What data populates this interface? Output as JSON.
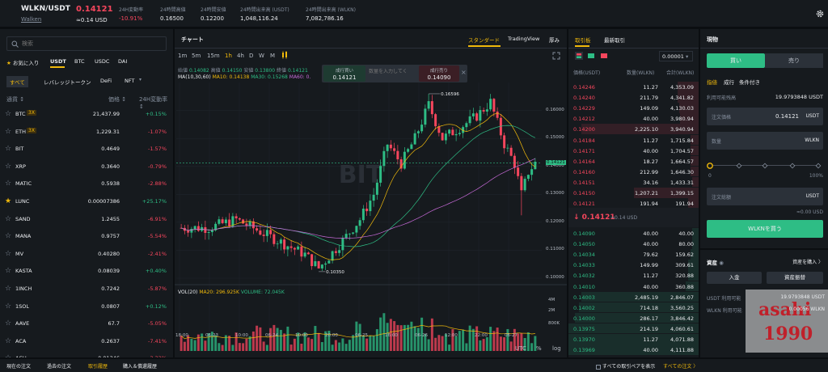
{
  "header": {
    "pair": "WLKN/USDT",
    "sub": "Walken",
    "price": "0.14121",
    "price_usd": "≈0.14 USD",
    "stats": [
      {
        "label": "24H変動率",
        "value": "-10.91%",
        "color": "#f6465d"
      },
      {
        "label": "24時間高値",
        "value": "0.16500"
      },
      {
        "label": "24時間安値",
        "value": "0.12200"
      },
      {
        "label": "24時間出来高 (USDT)",
        "value": "1,048,116.24"
      },
      {
        "label": "24時間出来高 (WLKN)",
        "value": "7,082,786.16"
      }
    ]
  },
  "market": {
    "search_placeholder": "検索",
    "tabs": [
      "お気に入り",
      "USDT",
      "BTC",
      "USDC",
      "DAI"
    ],
    "subtabs": [
      "すべて",
      "レバレッジトークン",
      "DeFi",
      "NFT"
    ],
    "col_pair": "通貨 ↕",
    "col_price": "価格 ↕",
    "col_change": "24H変動率 ↕",
    "rows": [
      {
        "sym": "BTC",
        "lev": "3X",
        "price": "21,437.99",
        "change": "+0.15%",
        "up": true,
        "fav": false
      },
      {
        "sym": "ETH",
        "lev": "3X",
        "price": "1,229.31",
        "change": "-1.07%",
        "up": false,
        "fav": false
      },
      {
        "sym": "BIT",
        "lev": "",
        "price": "0.4649",
        "change": "-1.57%",
        "up": false,
        "fav": false
      },
      {
        "sym": "XRP",
        "lev": "",
        "price": "0.3640",
        "change": "-0.79%",
        "up": false,
        "fav": false
      },
      {
        "sym": "MATIC",
        "lev": "",
        "price": "0.5938",
        "change": "-2.88%",
        "up": false,
        "fav": false
      },
      {
        "sym": "LUNC",
        "lev": "",
        "price": "0.00007386",
        "change": "+25.17%",
        "up": true,
        "fav": true
      },
      {
        "sym": "SAND",
        "lev": "",
        "price": "1.2455",
        "change": "-6.91%",
        "up": false,
        "fav": false
      },
      {
        "sym": "MANA",
        "lev": "",
        "price": "0.9757",
        "change": "-5.54%",
        "up": false,
        "fav": false
      },
      {
        "sym": "MV",
        "lev": "",
        "price": "0.40280",
        "change": "-2.41%",
        "up": false,
        "fav": false
      },
      {
        "sym": "KASTA",
        "lev": "",
        "price": "0.08039",
        "change": "+0.40%",
        "up": true,
        "fav": false
      },
      {
        "sym": "1INCH",
        "lev": "",
        "price": "0.7242",
        "change": "-5.87%",
        "up": false,
        "fav": false
      },
      {
        "sym": "1SOL",
        "lev": "",
        "price": "0.0807",
        "change": "+0.12%",
        "up": true,
        "fav": false
      },
      {
        "sym": "AAVE",
        "lev": "",
        "price": "67.7",
        "change": "-5.05%",
        "up": false,
        "fav": false
      },
      {
        "sym": "ACA",
        "lev": "",
        "price": "0.2637",
        "change": "-7.41%",
        "up": false,
        "fav": false
      },
      {
        "sym": "ACH",
        "lev": "",
        "price": "0.01346",
        "change": "-3.32%",
        "up": false,
        "fav": false
      }
    ]
  },
  "chart": {
    "title": "チャート",
    "view_tabs": [
      "スタンダード",
      "TradingView",
      "厚み"
    ],
    "intervals": [
      "1m",
      "5m",
      "15m",
      "1h",
      "4h",
      "D",
      "W",
      "M"
    ],
    "ohlc": {
      "open_l": "始値",
      "open": "0.14082",
      "high_l": "高値",
      "high": "0.14150",
      "low_l": "安値",
      "low": "0.13800",
      "close_l": "終値",
      "close": "0.14121"
    },
    "ma_label": "MA(10,30,60)",
    "ma10": "MA10: 0.14138",
    "ma30": "MA30: 0.15268",
    "ma60": "MA60: 0.",
    "quick_buy": "成行買い",
    "quick_buy_price": "0.14121",
    "qty_placeholder": "数量を入力してく",
    "quick_sell": "成行売り",
    "quick_sell_price": "0.14090",
    "watermark": "BIT",
    "vol_label": "VOL(20)",
    "vol_ma20": "MA20: 296.925K",
    "vol_volume": "VOLUME: 72.045K",
    "vol_axis": [
      "4M",
      "2M",
      "800K"
    ],
    "price_axis": [
      "0.16000",
      "0.15000",
      "0.14000",
      "0.13000",
      "0.12000",
      "0.11000",
      "0.10000"
    ],
    "last_price_tag": "0.14121",
    "high_mark": "0.16596",
    "low_mark": "0.10350",
    "time_axis": [
      "18:00",
      "06-23",
      "10:00",
      "06-24",
      "10:00",
      "20:00",
      "06-25",
      "16:00",
      "06-26",
      "12:00",
      "22:00",
      "06-27"
    ],
    "footer": [
      "UTC",
      "%",
      "log"
    ],
    "colors": {
      "up": "#2ebd85",
      "down": "#f6465d",
      "ma10": "#f0b90b",
      "ma30": "#2ebd85",
      "ma60": "#c76ad8"
    }
  },
  "orderbook": {
    "tabs": [
      "取引板",
      "最新取引"
    ],
    "precision": "0.00001",
    "col_price": "価格(USDT)",
    "col_qty": "数量(WLKN)",
    "col_total": "合計(WLKN)",
    "asks": [
      [
        "0.14246",
        "11.27",
        "4,353.09"
      ],
      [
        "0.14240",
        "211.79",
        "4,341.82"
      ],
      [
        "0.14229",
        "149.09",
        "4,130.03"
      ],
      [
        "0.14212",
        "40.00",
        "3,980.94"
      ],
      [
        "0.14200",
        "2,225.10",
        "3,940.94"
      ],
      [
        "0.14184",
        "11.27",
        "1,715.84"
      ],
      [
        "0.14171",
        "40.00",
        "1,704.57"
      ],
      [
        "0.14164",
        "18.27",
        "1,664.57"
      ],
      [
        "0.14160",
        "212.99",
        "1,646.30"
      ],
      [
        "0.14151",
        "34.16",
        "1,433.31"
      ],
      [
        "0.14150",
        "1,207.21",
        "1,399.15"
      ],
      [
        "0.14121",
        "191.94",
        "191.94"
      ]
    ],
    "ask_depth": [
      0.16,
      0.16,
      0.15,
      0.14,
      0.9,
      0.06,
      0.06,
      0.06,
      0.06,
      0.05,
      0.5,
      0.08
    ],
    "last_price": "↓ 0.14121",
    "last_usd": "≈0.14 USD",
    "bids": [
      [
        "0.14090",
        "40.00",
        "40.00"
      ],
      [
        "0.14050",
        "40.00",
        "80.00"
      ],
      [
        "0.14034",
        "79.62",
        "159.62"
      ],
      [
        "0.14033",
        "149.99",
        "309.61"
      ],
      [
        "0.14032",
        "11.27",
        "320.88"
      ],
      [
        "0.14010",
        "40.00",
        "360.88"
      ],
      [
        "0.14003",
        "2,485.19",
        "2,846.07"
      ],
      [
        "0.14002",
        "714.18",
        "3,560.25"
      ],
      [
        "0.14000",
        "286.17",
        "3,846.42"
      ],
      [
        "0.13975",
        "214.19",
        "4,060.61"
      ],
      [
        "0.13970",
        "11.27",
        "4,071.88"
      ],
      [
        "0.13969",
        "40.00",
        "4,111.88"
      ]
    ],
    "bid_depth": [
      0.05,
      0.05,
      0.06,
      0.08,
      0.08,
      0.1,
      0.9,
      0.92,
      0.95,
      1.0,
      1.0,
      1.0
    ]
  },
  "trade": {
    "title": "現物",
    "buy_tab": "買い",
    "sell_tab": "売り",
    "order_types": [
      "指値",
      "成行",
      "条件付き"
    ],
    "available_label": "利用可能残高",
    "available": "19.9793848 USDT",
    "price_label": "注文価格",
    "price_value": "0.14121",
    "price_unit": "USDT",
    "qty_label": "数量",
    "qty_unit": "WLKN",
    "slider_min": "0",
    "slider_max": "100%",
    "amount_label": "注文総額",
    "amount_unit": "USDT",
    "amount_usd": "≈0.00 USD",
    "submit": "WLKNを買う"
  },
  "assets": {
    "title": "資産",
    "deposit_link": "資産を購入 〉",
    "deposit_btn": "入金",
    "transfer_btn": "資産振替",
    "usdt_label": "USDT 利用可能",
    "usdt_value": "19.9793848 USDT",
    "wlkn_label": "WLKN 利用可能",
    "wlkn_value": "0.00056 WLKN"
  },
  "bottom_tabs": [
    "現在の注文",
    "過去の注文",
    "取引履歴",
    "購入＆償還履歴"
  ],
  "bottom_right": {
    "show_all": "すべての取引ペアを表示",
    "all": "すべての注文 〉"
  },
  "watermark": {
    "line1": "asahi",
    "line2": "1990"
  }
}
